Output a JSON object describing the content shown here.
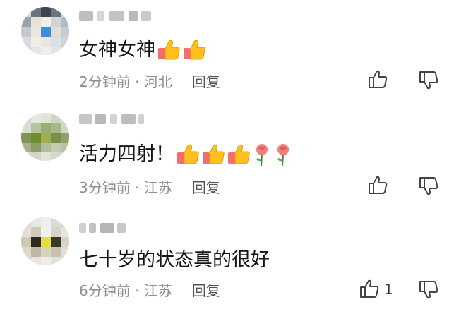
{
  "comments": [
    {
      "text": "女神女神",
      "time": "2分钟前",
      "location": "河北",
      "reply_label": "回复",
      "like_count": "",
      "emoji": [
        "thumbs-up-icon",
        "thumbs-up-icon"
      ]
    },
    {
      "text": "活力四射！",
      "time": "3分钟前",
      "location": "江苏",
      "reply_label": "回复",
      "like_count": "",
      "emoji": [
        "thumbs-up-icon",
        "thumbs-up-icon",
        "thumbs-up-icon",
        "rose-icon",
        "rose-icon"
      ]
    },
    {
      "text": "七十岁的状态真的很好",
      "time": "6分钟前",
      "location": "江苏",
      "reply_label": "回复",
      "like_count": "1",
      "emoji": []
    }
  ],
  "separator": " · "
}
